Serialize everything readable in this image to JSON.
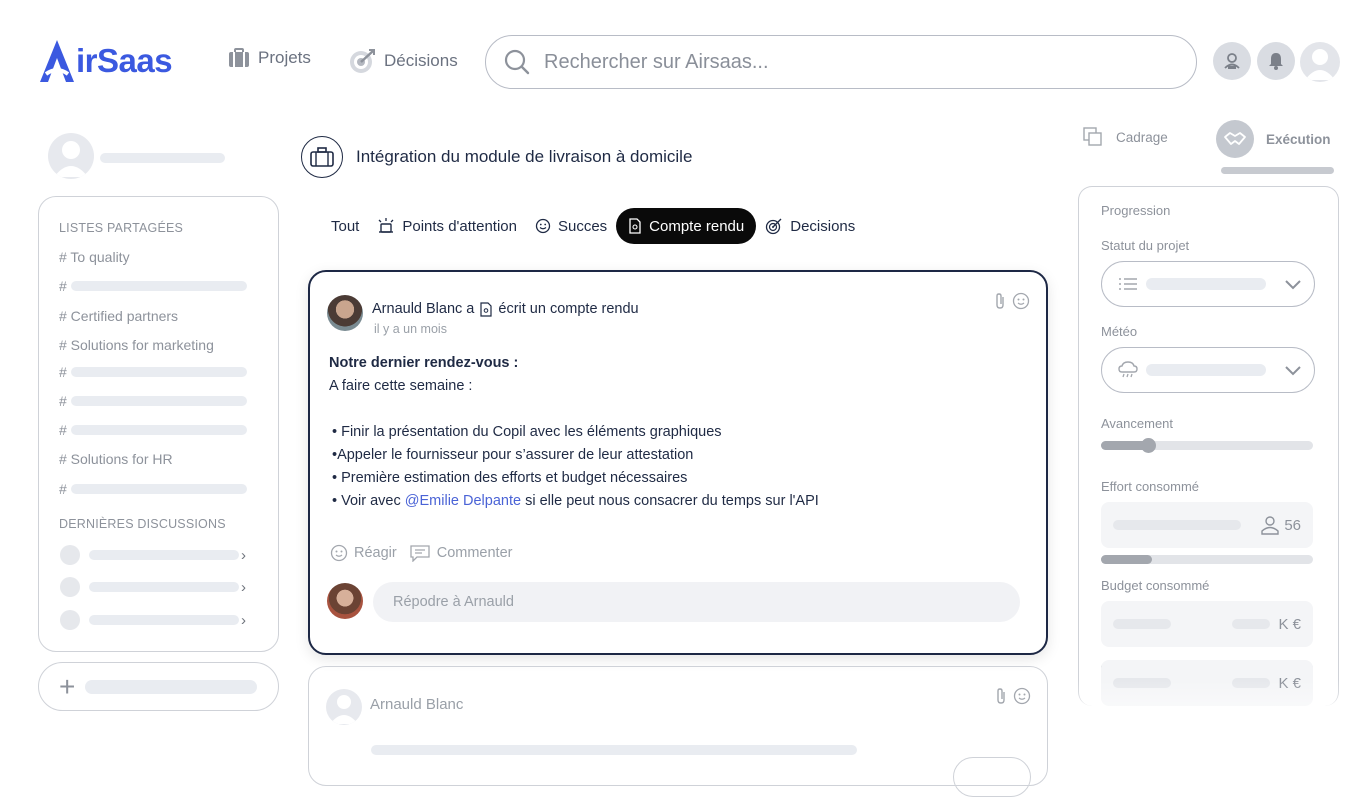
{
  "brand": {
    "logo_text": "irSaas",
    "accent": "#3b59e0"
  },
  "nav": {
    "projets": {
      "label": "Projets",
      "icon": "briefcase-icon"
    },
    "decisions": {
      "label": "Décisions",
      "icon": "target-icon"
    }
  },
  "search": {
    "placeholder": "Rechercher sur Airsaas..."
  },
  "sidebar": {
    "shared_lists_title": "LISTES PARTAGÉES",
    "lists": [
      {
        "label": "# To quality"
      },
      {
        "label": "#"
      },
      {
        "label": "# Certified partners"
      },
      {
        "label": "# Solutions for marketing"
      },
      {
        "label": "#"
      },
      {
        "label": "#"
      },
      {
        "label": "#"
      },
      {
        "label": "# Solutions for HR"
      },
      {
        "label": "#"
      }
    ],
    "discussions_title": "DERNIÈRES DISCUSSIONS"
  },
  "project": {
    "title": "Intégration du module de livraison à domicile"
  },
  "tabs": [
    {
      "label": "Tout",
      "active": false
    },
    {
      "label": "Points d'attention",
      "active": false
    },
    {
      "label": "Succes",
      "active": false
    },
    {
      "label": "Compte rendu",
      "active": true
    },
    {
      "label": "Decisions",
      "active": false
    }
  ],
  "post": {
    "author_action_prefix": "Arnauld Blanc a",
    "author_action_suffix": "écrit un compte rendu",
    "time": "il y a un mois",
    "heading": "Notre dernier rendez-vous :",
    "subheading": "A faire cette semaine :",
    "bullets": [
      "• Finir la présentation du Copil avec les éléments graphiques",
      "•Appeler le fournisseur pour s’assurer de leur attestation",
      "• Première estimation des efforts et budget nécessaires"
    ],
    "last_bullet_prefix": "• Voir avec ",
    "mention": "@Emilie Delpante",
    "last_bullet_suffix": " si elle peut nous consacrer du temps sur l'API",
    "react_label": "Réagir",
    "comment_label": "Commenter",
    "reply_placeholder": "Répodre à Arnauld"
  },
  "post2": {
    "author": "Arnauld Blanc"
  },
  "phases": {
    "cadrage": "Cadrage",
    "execution": "Exécution"
  },
  "right_panel": {
    "progression": "Progression",
    "statut": "Statut du projet",
    "meteo": "Météo",
    "avancement": "Avancement",
    "avancement_value": 0.22,
    "effort": "Effort consommé",
    "effort_value": "56",
    "effort_fill": 0.24,
    "budget": "Budget consommé",
    "budget_unit_1": "K €",
    "budget_fill_1": 0.1,
    "budget_unit_2": "K €",
    "budget_fill_2": 0.43
  }
}
